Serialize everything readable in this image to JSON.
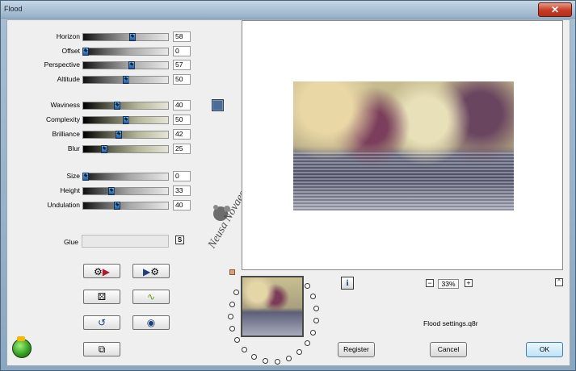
{
  "window": {
    "title": "Flood",
    "close_label": "✕"
  },
  "params": [
    {
      "name": "horizon",
      "label": "Horizon",
      "value": "58"
    },
    {
      "name": "offset",
      "label": "Offset",
      "value": "0"
    },
    {
      "name": "perspective",
      "label": "Perspective",
      "value": "57"
    },
    {
      "name": "altitude",
      "label": "Altitude",
      "value": "50"
    },
    {
      "name": "waviness",
      "label": "Waviness",
      "value": "40"
    },
    {
      "name": "complexity",
      "label": "Complexity",
      "value": "50"
    },
    {
      "name": "brilliance",
      "label": "Brilliance",
      "value": "42"
    },
    {
      "name": "blur",
      "label": "Blur",
      "value": "25"
    },
    {
      "name": "size",
      "label": "Size",
      "value": "0"
    },
    {
      "name": "height",
      "label": "Height",
      "value": "33"
    },
    {
      "name": "undulation",
      "label": "Undulation",
      "value": "40"
    }
  ],
  "glue": {
    "label": "Glue",
    "button": "S"
  },
  "color_swatch": "#4a6d96",
  "zoom": {
    "value": "33%",
    "minus": "−",
    "plus": "+"
  },
  "info_label": "i",
  "up_label": "^",
  "settings_name": "Flood settings.q8r",
  "buttons": {
    "register": "Register",
    "cancel": "Cancel",
    "ok": "OK"
  },
  "watermark_text": "Neusa Novaes"
}
